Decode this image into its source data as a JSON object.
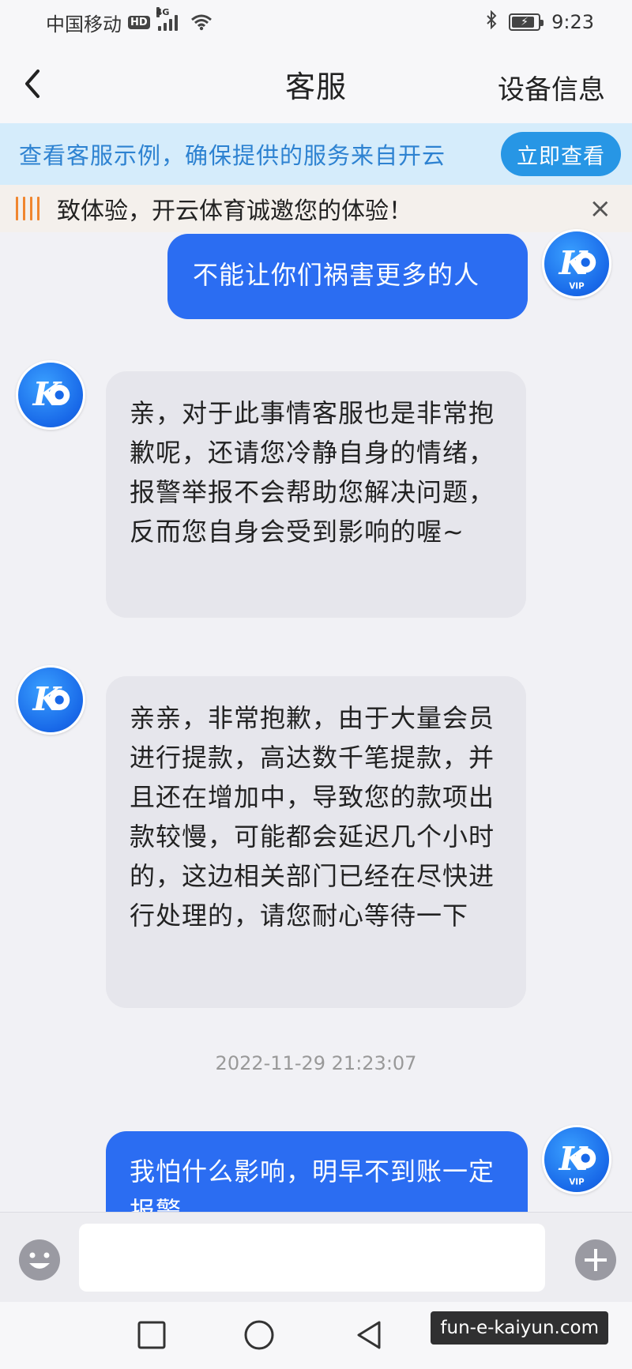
{
  "status_bar": {
    "carrier": "中国移动",
    "hd_badge": "HD",
    "network": "4G",
    "time": "9:23"
  },
  "header": {
    "title": "客服",
    "device_info_label": "设备信息",
    "back_icon": "chevron-left-icon"
  },
  "notice": {
    "text": "查看客服示例，确保提供的服务来自开云",
    "button_label": "立即查看"
  },
  "marquee": {
    "text": "致体验，开云体育诚邀您的体验！",
    "close_symbol": "×",
    "accent_color": "#f0862f"
  },
  "messages": [
    {
      "side": "out",
      "text": "不能让你们祸害更多的人",
      "avatar_badge": "VIP"
    },
    {
      "side": "in",
      "text": "亲，对于此事情客服也是非常抱歉呢，还请您冷静自身的情绪，报警举报不会帮助您解决问题，反而您自身会受到影响的喔~"
    },
    {
      "side": "in",
      "text": "亲亲，非常抱歉，由于大量会员进行提款，高达数千笔提款，并且还在增加中，导致您的款项出款较慢，可能都会延迟几个小时的，这边相关部门已经在尽快进行处理的，请您耐心等待一下"
    },
    {
      "side": "out",
      "text": "我怕什么影响，明早不到账一定报警",
      "avatar_badge": "VIP"
    }
  ],
  "timestamp": "2022-11-29 21:23:07",
  "input": {
    "value": "",
    "emoji_icon": "emoji-icon",
    "plus_icon": "plus-icon"
  },
  "watermark": "fun-e-kaiyun.com",
  "colors": {
    "outgoing_bubble": "#2b6df2",
    "incoming_bubble": "#e6e6ec",
    "notice_bg": "#d5ecfb",
    "notice_button": "#2796e5"
  }
}
